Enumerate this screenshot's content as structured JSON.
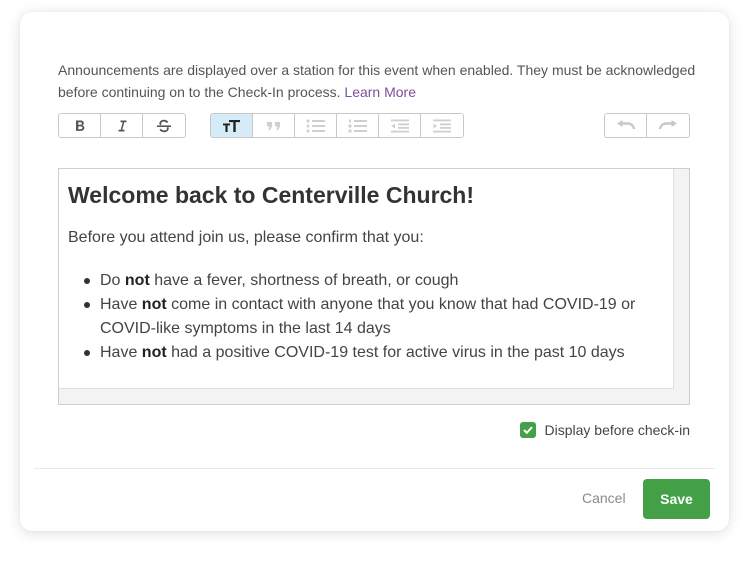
{
  "help": {
    "text": "Announcements are displayed over a station for this event when enabled. They must be acknowledged before continuing on to the Check-In process.",
    "link": "Learn More"
  },
  "toolbar": {
    "format_buttons": [
      {
        "name": "bold-icon",
        "active": false
      },
      {
        "name": "italic-icon",
        "active": false
      },
      {
        "name": "strikethrough-icon",
        "active": false
      }
    ],
    "block_buttons": [
      {
        "name": "heading-icon",
        "active": true
      },
      {
        "name": "quote-icon",
        "active": false
      },
      {
        "name": "bullet-list-icon",
        "active": false
      },
      {
        "name": "numbered-list-icon",
        "active": false
      },
      {
        "name": "outdent-icon",
        "active": false
      },
      {
        "name": "indent-icon",
        "active": false
      }
    ],
    "history_buttons": [
      {
        "name": "undo-icon",
        "active": false
      },
      {
        "name": "redo-icon",
        "active": false
      }
    ]
  },
  "editor": {
    "heading": "Welcome back to Centerville Church!",
    "intro": "Before you attend join us, please confirm that you:",
    "items": [
      {
        "before": "Do ",
        "bold": "not",
        "after": " have a fever, shortness of breath, or cough"
      },
      {
        "before": "Have ",
        "bold": "not",
        "after": " come in contact with anyone that you know that had COVID-19 or COVID-like symptoms in the last 14 days"
      },
      {
        "before": "Have ",
        "bold": "not",
        "after": " had a positive COVID-19 test for active virus in the past 10 days"
      }
    ]
  },
  "display_checkbox": {
    "label": "Display before check-in",
    "checked": true
  },
  "footer": {
    "cancel_label": "Cancel",
    "save_label": "Save"
  },
  "colors": {
    "accent_green": "#43a047",
    "link_purple": "#7d4f9e",
    "active_tool_bg": "#d5ebf7"
  }
}
